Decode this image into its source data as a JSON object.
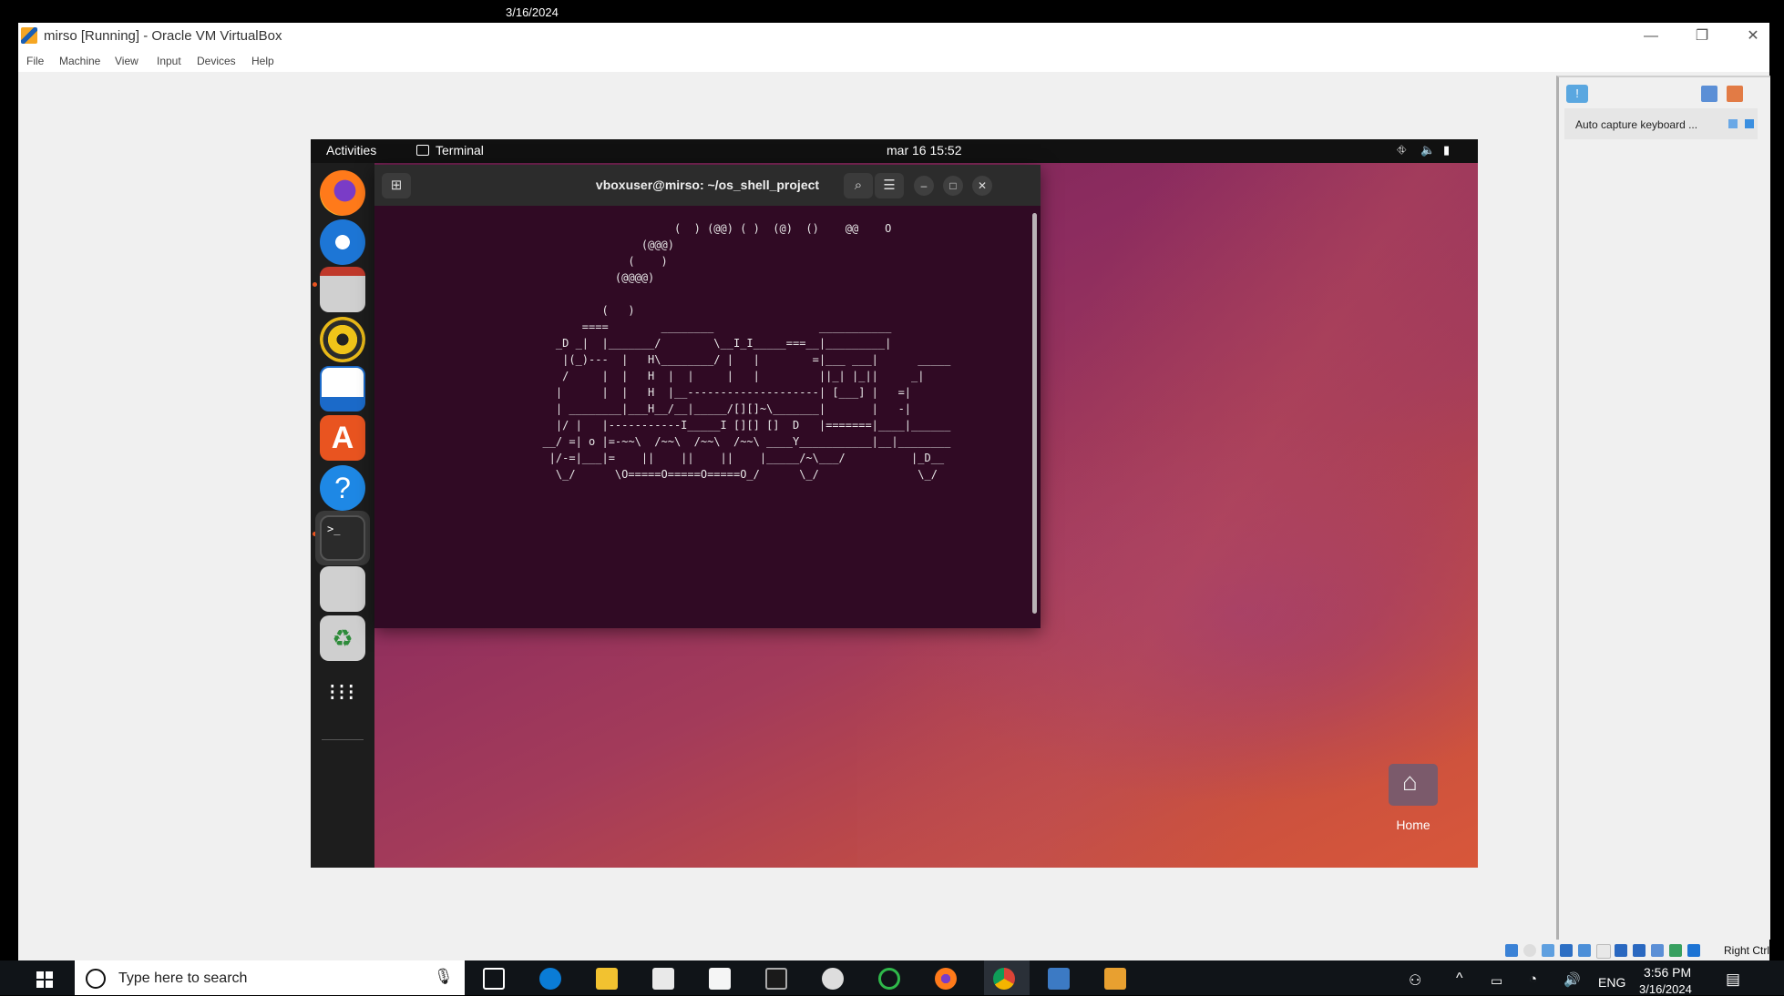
{
  "top_strip": {
    "date": "3/16/2024"
  },
  "vbox": {
    "title": "mirso [Running] - Oracle VM VirtualBox",
    "window_controls": [
      "—",
      "❐",
      "✕"
    ],
    "menu": [
      "File",
      "Machine",
      "View",
      "Input",
      "Devices",
      "Help"
    ],
    "host_key": "Right Ctrl"
  },
  "guest": {
    "topbar": {
      "activities": "Activities",
      "app": "Terminal",
      "clock": "mar 16  15:52",
      "tray_icons": [
        "network-icon",
        "volume-icon",
        "battery-icon"
      ]
    },
    "dock": [
      "firefox",
      "thunderbird",
      "files",
      "rhythmbox",
      "libreoffice-writer",
      "ubuntu-software",
      "help",
      "terminal",
      "text-editor",
      "trash",
      "show-apps"
    ],
    "terminal": {
      "title": "vboxuser@mirso: ~/os_shell_project",
      "ascii_art": "                      (  ) (@@) ( )  (@)  ()    @@    O\n                 (@@@)\n               (    )\n             (@@@@)\n\n           (   )\n        ====        ________                ___________\n    _D _|  |_______/        \\__I_I_____===__|_________|\n     |(_)---  |   H\\________/ |   |        =|___ ___|      _____\n     /     |  |   H  |  |     |   |         ||_| |_||     _|\n    |      |  |   H  |__--------------------| [___] |   =|\n    | ________|___H__/__|_____/[][]~\\_______|       |   -|\n    |/ |   |-----------I_____I [][] []  D   |=======|____|______\n  __/ =| o |=-~~\\  /~~\\  /~~\\  /~~\\ ____Y___________|__|________\n   |/-=|___|=    ||    ||    ||    |_____/~\\___/          |_D__\n    \\_/      \\O=====O=====O=====O_/      \\_/               \\_/"
    },
    "desktop": {
      "home_label": "Home"
    }
  },
  "notification": {
    "message": "Auto capture keyboard ..."
  },
  "taskbar": {
    "search_placeholder": "Type here to search",
    "lang": "ENG",
    "time": "3:56 PM",
    "date": "3/16/2024"
  }
}
